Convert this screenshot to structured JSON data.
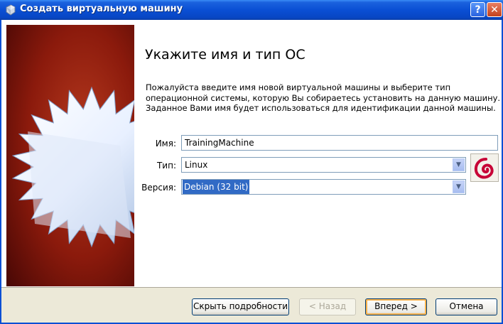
{
  "window": {
    "title": "Создать виртуальную машину",
    "help_glyph": "?",
    "close_glyph": "✕"
  },
  "page": {
    "heading": "Укажите имя и тип ОС",
    "description": "Пожалуйста введите имя новой виртуальной машины и выберите тип операционной системы, которую Вы собираетесь установить на данную машину. Заданное Вами имя будет использоваться для идентификации данной машины."
  },
  "form": {
    "name_label": "Имя:",
    "name_value": "TrainingMachine",
    "type_label": "Тип:",
    "type_value": "Linux",
    "version_label": "Версия:",
    "version_value": "Debian (32 bit)"
  },
  "icons": {
    "title": "virtualbox-icon",
    "os": "debian-logo-icon",
    "banner": "star-banner-icon"
  },
  "buttons": {
    "details": "Скрыть подробности",
    "back": "< Назад",
    "next": "Вперед >",
    "cancel": "Отмена"
  },
  "colors": {
    "titlebar": "#0a4fd4",
    "banner_red": "#8b1a0c",
    "selection": "#316ac5",
    "debian_red": "#c70036"
  }
}
